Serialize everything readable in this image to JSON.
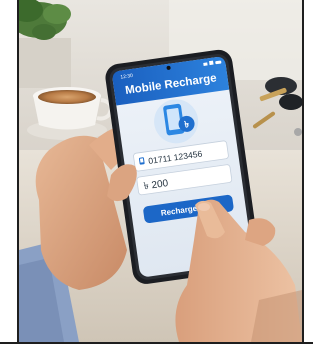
{
  "app": {
    "title": "Mobile Recharge",
    "status_time": "12:30"
  },
  "form": {
    "phone_number": "01711 123456",
    "amount": "৳ 200",
    "currency_icon": "taka-sign"
  },
  "actions": {
    "recharge_label": "Recharge Now"
  },
  "colors": {
    "header_blue": "#1f6fce",
    "button_blue": "#1c67c7",
    "icon_blue": "#2b87e3"
  }
}
